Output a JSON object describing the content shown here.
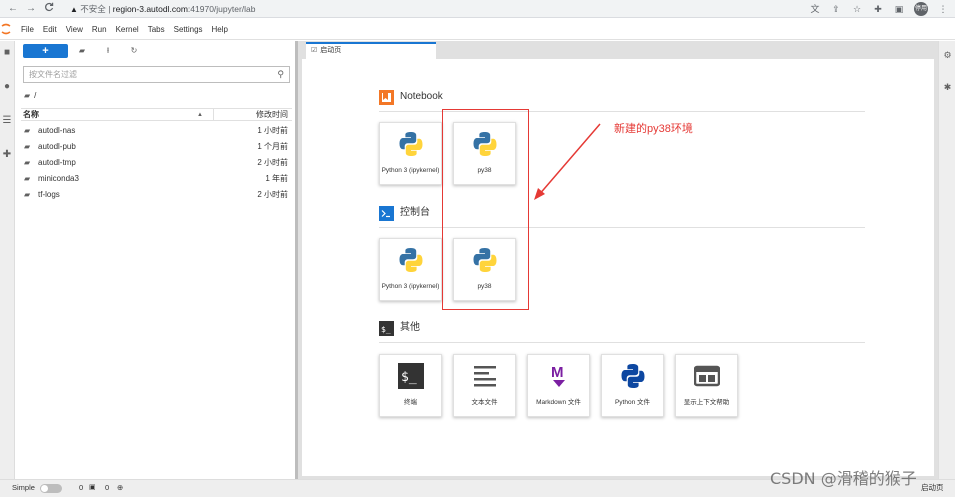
{
  "browser": {
    "back": "←",
    "forward": "→",
    "reload": "C",
    "security_label": "不安全",
    "separator": "|",
    "host": "region-3.autodl.com",
    "path": ":41970/jupyter/lab",
    "avatar_text": "停用"
  },
  "menu": {
    "items": [
      "File",
      "Edit",
      "View",
      "Run",
      "Kernel",
      "Tabs",
      "Settings",
      "Help"
    ]
  },
  "filebrowser": {
    "new_label": "+",
    "filter_placeholder": "按文件名过滤",
    "breadcrumb": "/",
    "col_name": "名称",
    "col_modified": "修改时间",
    "files": [
      {
        "name": "autodl-nas",
        "modified": "1 小时前"
      },
      {
        "name": "autodl-pub",
        "modified": "1 个月前"
      },
      {
        "name": "autodl-tmp",
        "modified": "2 小时前"
      },
      {
        "name": "miniconda3",
        "modified": "1 年前"
      },
      {
        "name": "tf-logs",
        "modified": "2 小时前"
      }
    ]
  },
  "tab": {
    "label": "启动页"
  },
  "launcher": {
    "notebook_title": "Notebook",
    "console_title": "控制台",
    "other_title": "其他",
    "notebook_cards": [
      {
        "label": "Python 3 (ipykernel)"
      },
      {
        "label": "py38"
      }
    ],
    "console_cards": [
      {
        "label": "Python 3 (ipykernel)"
      },
      {
        "label": "py38"
      }
    ],
    "other_cards": [
      {
        "label": "终端"
      },
      {
        "label": "文本文件"
      },
      {
        "label": "Markdown 文件"
      },
      {
        "label": "Python 文件"
      },
      {
        "label": "显示上下文帮助"
      }
    ]
  },
  "annotation": {
    "text": "新建的py38环境"
  },
  "statusbar": {
    "simple_label": "Simple",
    "kernels_count": "0",
    "terminals_count": "0",
    "right_label": "启动页"
  },
  "watermark": "CSDN @滑稽的猴子",
  "colors": {
    "accent": "#1976d2",
    "annotation": "#e53935",
    "jupyter_orange": "#f37726",
    "python_blue": "#3572a5",
    "python_yellow": "#ffd43b"
  }
}
